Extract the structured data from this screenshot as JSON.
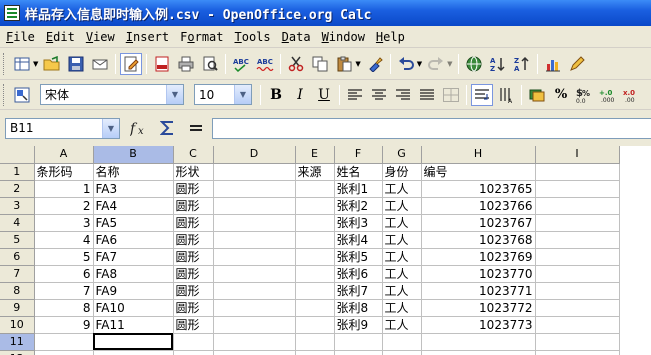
{
  "window": {
    "title": "样品存入信息即时输入例.csv - OpenOffice.org Calc"
  },
  "menu": [
    {
      "label": "File",
      "u": "F",
      "rest": "ile"
    },
    {
      "label": "Edit",
      "u": "E",
      "rest": "dit"
    },
    {
      "label": "View",
      "u": "V",
      "rest": "iew"
    },
    {
      "label": "Insert",
      "u": "I",
      "rest": "nsert"
    },
    {
      "label": "Format",
      "u": "o",
      "pre": "F",
      "rest": "rmat"
    },
    {
      "label": "Tools",
      "u": "T",
      "rest": "ools"
    },
    {
      "label": "Data",
      "u": "D",
      "rest": "ata"
    },
    {
      "label": "Window",
      "u": "W",
      "rest": "indow"
    },
    {
      "label": "Help",
      "u": "H",
      "rest": "elp"
    }
  ],
  "format_toolbar": {
    "font_name": "宋体",
    "font_size": "10",
    "bold": "B",
    "italic": "I",
    "underline": "U",
    "currency": "$",
    "percent": "%"
  },
  "formula_bar": {
    "name_box": "B11",
    "formula": ""
  },
  "columns": [
    "A",
    "B",
    "C",
    "D",
    "E",
    "F",
    "G",
    "H",
    "I"
  ],
  "selected_column": "B",
  "selected_row": "11",
  "rows": [
    {
      "n": "1",
      "cells": [
        "条形码",
        "名称",
        "形状",
        "",
        "来源",
        "姓名",
        "身份",
        "编号",
        ""
      ]
    },
    {
      "n": "2",
      "cells": [
        "1",
        "FA3",
        "圆形",
        "",
        "",
        "张利1",
        "工人",
        "1023765",
        ""
      ]
    },
    {
      "n": "3",
      "cells": [
        "2",
        "FA4",
        "圆形",
        "",
        "",
        "张利2",
        "工人",
        "1023766",
        ""
      ]
    },
    {
      "n": "4",
      "cells": [
        "3",
        "FA5",
        "圆形",
        "",
        "",
        "张利3",
        "工人",
        "1023767",
        ""
      ]
    },
    {
      "n": "5",
      "cells": [
        "4",
        "FA6",
        "圆形",
        "",
        "",
        "张利4",
        "工人",
        "1023768",
        ""
      ]
    },
    {
      "n": "6",
      "cells": [
        "5",
        "FA7",
        "圆形",
        "",
        "",
        "张利5",
        "工人",
        "1023769",
        ""
      ]
    },
    {
      "n": "7",
      "cells": [
        "6",
        "FA8",
        "圆形",
        "",
        "",
        "张利6",
        "工人",
        "1023770",
        ""
      ]
    },
    {
      "n": "8",
      "cells": [
        "7",
        "FA9",
        "圆形",
        "",
        "",
        "张利7",
        "工人",
        "1023771",
        ""
      ]
    },
    {
      "n": "9",
      "cells": [
        "8",
        "FA10",
        "圆形",
        "",
        "",
        "张利8",
        "工人",
        "1023772",
        ""
      ]
    },
    {
      "n": "10",
      "cells": [
        "9",
        "FA11",
        "圆形",
        "",
        "",
        "张利9",
        "工人",
        "1023773",
        ""
      ]
    },
    {
      "n": "11",
      "cells": [
        "",
        "",
        "",
        "",
        "",
        "",
        "",
        "",
        ""
      ]
    },
    {
      "n": "12",
      "cells": [
        "",
        "",
        "",
        "",
        "",
        "",
        "",
        "",
        ""
      ]
    }
  ]
}
